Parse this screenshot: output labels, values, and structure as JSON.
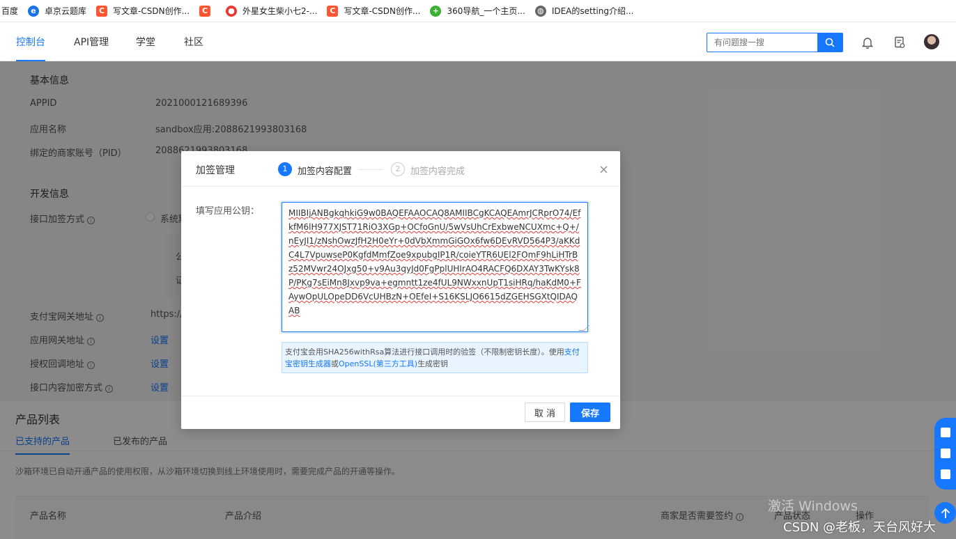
{
  "bookmarks": [
    {
      "label": "百度",
      "icon": "none"
    },
    {
      "label": "卓京云题库",
      "icon": "globe-icon"
    },
    {
      "label": "写文章-CSDN创作...",
      "icon": "csdn-icon"
    },
    {
      "label": "",
      "icon": "csdn-icon"
    },
    {
      "label": "外星女生柴小七2-...",
      "icon": "red-circle-icon"
    },
    {
      "label": "写文章-CSDN创作...",
      "icon": "csdn-icon"
    },
    {
      "label": "360导航_一个主页...",
      "icon": "360-icon"
    },
    {
      "label": "IDEA的setting介绍...",
      "icon": "globe-icon"
    }
  ],
  "nav": {
    "items": [
      "控制台",
      "API管理",
      "学堂",
      "社区"
    ],
    "search_placeholder": "有问题搜一搜"
  },
  "basic_info": {
    "title": "基本信息",
    "rows": [
      {
        "label": "APPID",
        "value": "2021000121689396"
      },
      {
        "label": "应用名称",
        "value": "sandbox应用:2088621993803168"
      },
      {
        "label": "绑定的商家账号（PID）",
        "value": "2088621993803168"
      }
    ]
  },
  "dev_info": {
    "title": "开发信息",
    "sign_method_label": "接口加签方式",
    "sign_method_value": "系统默",
    "gray_card_lines": [
      "公",
      "证"
    ],
    "rows": [
      {
        "label": "支付宝网关地址",
        "value": "https://c"
      },
      {
        "label": "应用网关地址",
        "value": "设置"
      },
      {
        "label": "授权回调地址",
        "value": "设置"
      },
      {
        "label": "接口内容加密方式",
        "value": "设置"
      }
    ]
  },
  "products": {
    "title": "产品列表",
    "tabs": [
      "已支持的产品",
      "已发布的产品"
    ],
    "notice": "沙箱环境已自动开通产品的使用权限，从沙箱环境切换到线上环境使用时，需要完成产品的开通等操作。",
    "columns": [
      "产品名称",
      "产品介绍",
      "商家是否需要签约",
      "产品状态",
      "操作"
    ]
  },
  "modal": {
    "title": "加签管理",
    "steps": [
      {
        "num": "1",
        "label": "加签内容配置"
      },
      {
        "num": "2",
        "label": "加签内容完成"
      }
    ],
    "field_label": "填写应用公钥：",
    "public_key": "MIIBIjANBgkqhkiG9w0BAQEFAAOCAQ8AMIIBCgKCAQEAmrJCRprO74/EfkfM6lH977XJST71RiO3XGp+OCfoGnU/5wVsUhCrExbweNCUXmc+Q+/nEyJI1/zNshOwzJfH2H0eYr+0dVbXmmGiGOx6fw6DEvRVD564P3/aKKdC4L7VpuwseP0KgfdMmfZoe9xpubgIP1R/coieYTR6UEl2FOmF9hLiHTrBz52MVwr24OJxg50+v9Au3qyJd0FgPplUHIrAO4RACFQ6DXAY3TwKYsk8P/PKg7sEiMn8Jxvp9va+egmntt1ze4fUL9NWxxnUpT1siHRq/haKdM0+FAywOpULOpeDD6VcUHBzN+OEfeI+S16KSLJO6615dZGEHSGXtQIDAQAB",
    "hint_prefix": "支付宝会用SHA256withRsa算法进行接口调用时的验签（不限制密钥长度）。使用",
    "hint_link1": "支付宝密钥生成器",
    "hint_mid": "或",
    "hint_link2": "OpenSSL(第三方工具)",
    "hint_suffix": "生成密钥",
    "cancel_label": "取 消",
    "save_label": "保存"
  },
  "overlay_text": {
    "windows_watermark": "激活 Windows",
    "csdn_watermark": "CSDN @老板，天台风好大"
  },
  "colors": {
    "accent": "#1677ff",
    "csdn": "#fc5531"
  }
}
